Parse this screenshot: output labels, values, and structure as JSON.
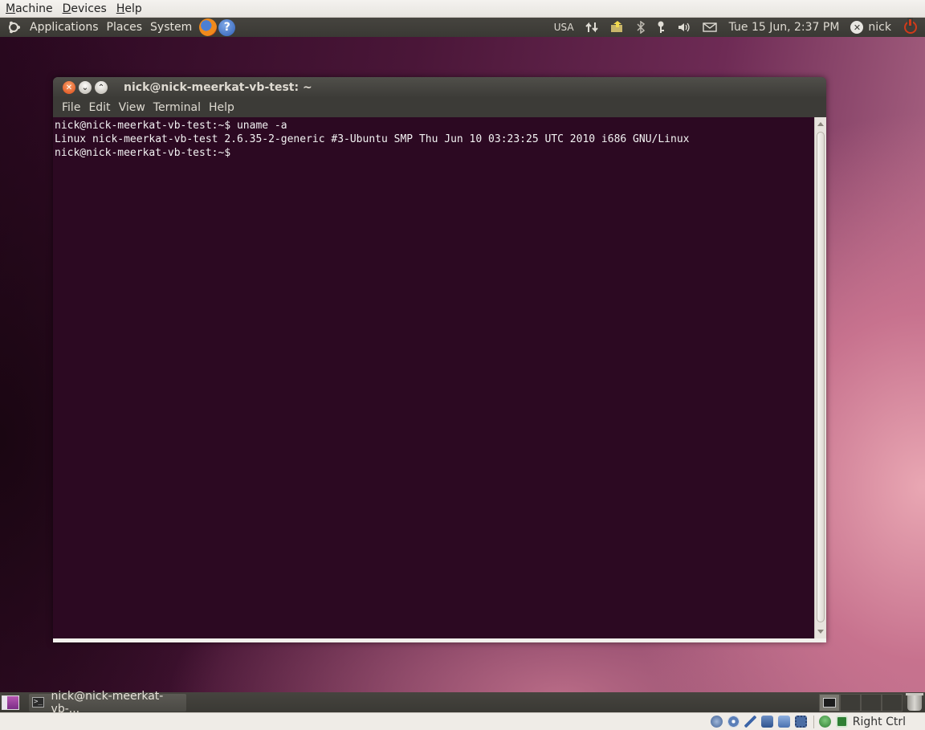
{
  "vbox_menu": {
    "items": [
      {
        "label": "Machine",
        "mnemonic": "M",
        "rest": "achine"
      },
      {
        "label": "Devices",
        "mnemonic": "D",
        "rest": "evices"
      },
      {
        "label": "Help",
        "mnemonic": "H",
        "rest": "elp"
      }
    ]
  },
  "top_panel": {
    "menus": [
      "Applications",
      "Places",
      "System"
    ],
    "keyboard_layout": "USA",
    "datetime": "Tue 15 Jun,  2:37 PM",
    "username": "nick",
    "icons": [
      "ubuntu-logo-icon",
      "firefox-icon",
      "help-icon",
      "network-icon",
      "update-icon",
      "bluetooth-icon",
      "key-icon",
      "volume-icon",
      "mail-icon",
      "power-icon"
    ]
  },
  "terminal": {
    "title": "nick@nick-meerkat-vb-test: ~",
    "menu": [
      "File",
      "Edit",
      "View",
      "Terminal",
      "Help"
    ],
    "lines": [
      "nick@nick-meerkat-vb-test:~$ uname -a",
      "Linux nick-meerkat-vb-test 2.6.35-2-generic #3-Ubuntu SMP Thu Jun 10 03:23:25 UTC 2010 i686 GNU/Linux",
      "nick@nick-meerkat-vb-test:~$ "
    ]
  },
  "bottom_panel": {
    "task_label": "nick@nick-meerkat-vb-..."
  },
  "vbox_status": {
    "host_key": "Right Ctrl"
  },
  "colors": {
    "terminal_bg": "#2c0922",
    "panel_bg": "#3c3b37",
    "close_button": "#df4a16"
  }
}
